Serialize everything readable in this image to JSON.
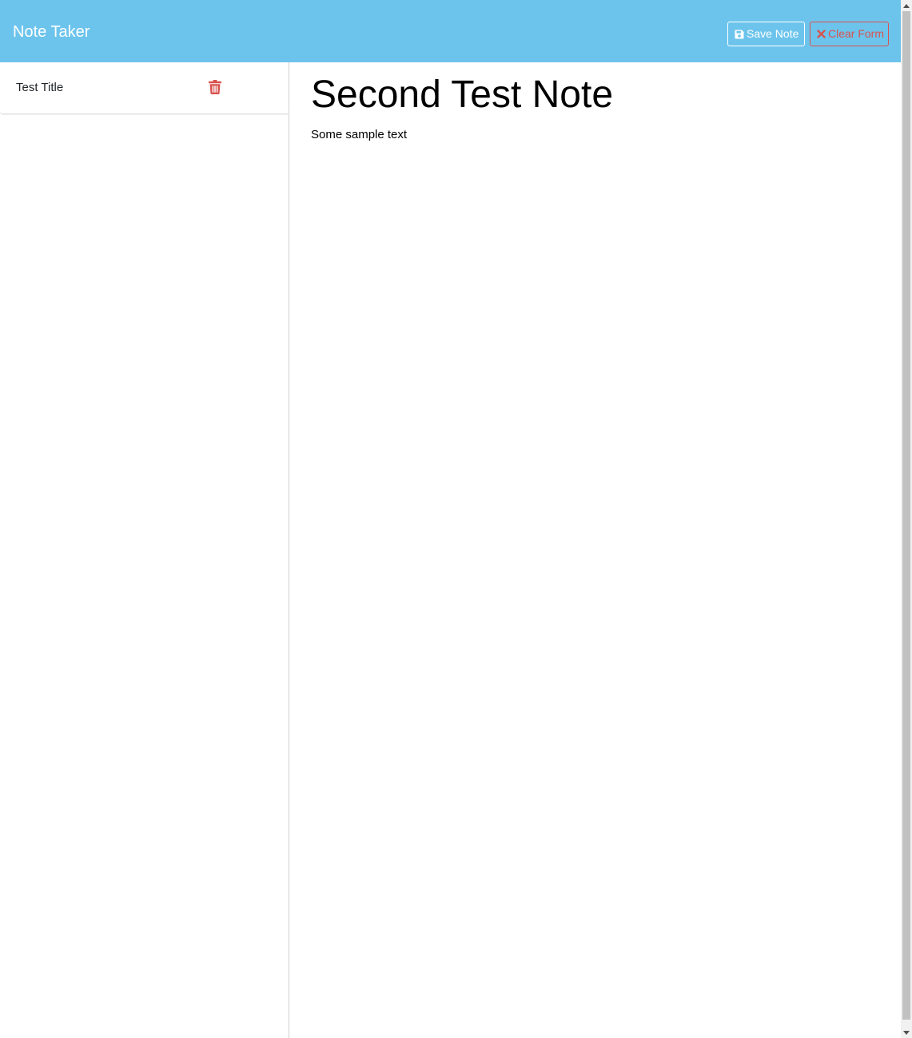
{
  "navbar": {
    "brand": "Note Taker",
    "save_label": "Save Note",
    "clear_label": "Clear Form",
    "save_icon": "floppy-disk-icon",
    "clear_icon": "close-icon"
  },
  "sidebar": {
    "notes": [
      {
        "title": "Test Title",
        "delete_icon": "trash-icon"
      }
    ]
  },
  "editor": {
    "title": "Second Test Note",
    "text": "Some sample text"
  },
  "colors": {
    "navbar_bg": "#6cc4ec",
    "danger": "#d9534f",
    "text": "#000000"
  }
}
